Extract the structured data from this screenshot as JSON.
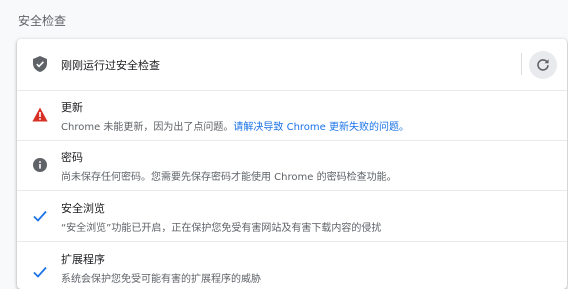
{
  "section_title": "安全检查",
  "summary": {
    "label": "刚刚运行过安全检查",
    "icon": "shield-check-icon",
    "action_icon": "refresh-icon"
  },
  "rows": [
    {
      "title": "更新",
      "subtitle": "Chrome 未能更新，因为出了点问题。",
      "link": "请解决导致 Chrome 更新失败的问题。",
      "icon": "warning-icon",
      "color": "#d93025"
    },
    {
      "title": "密码",
      "subtitle": "尚未保存任何密码。您需要先保存密码才能使用 Chrome 的密码检查功能。",
      "icon": "info-icon",
      "color": "#5f6368"
    },
    {
      "title": "安全浏览",
      "subtitle": "“安全浏览”功能已开启，正在保护您免受有害网站及有害下载内容的侵扰",
      "icon": "check-icon",
      "color": "#1a73e8"
    },
    {
      "title": "扩展程序",
      "subtitle": "系统会保护您免受可能有害的扩展程序的威胁",
      "icon": "check-icon",
      "color": "#1a73e8"
    }
  ]
}
